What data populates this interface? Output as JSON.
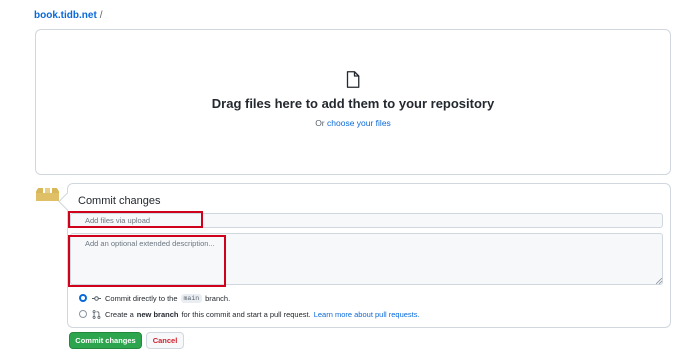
{
  "breadcrumb": {
    "repo": "book.tidb.net",
    "separator": "/"
  },
  "dropzone": {
    "title": "Drag files here to add them to your repository",
    "prefix": "Or",
    "link": "choose your files",
    "icon": "file-icon"
  },
  "commit": {
    "title": "Commit changes",
    "summary_placeholder": "Add files via upload",
    "description_placeholder": "Add an optional extended description...",
    "option_direct": {
      "prefix": "Commit directly to the",
      "branch": "main",
      "suffix": "branch.",
      "selected": true,
      "icon": "git-commit-icon"
    },
    "option_new_branch": {
      "prefix": "Create a",
      "bold": "new branch",
      "suffix": "for this commit and start a pull request.",
      "learn_more": "Learn more about pull requests.",
      "selected": false,
      "icon": "git-pull-request-icon"
    }
  },
  "buttons": {
    "commit": "Commit changes",
    "cancel": "Cancel"
  },
  "colors": {
    "accent": "#0969da",
    "primary_button": "#2da44e",
    "cancel_text": "#cf222e",
    "highlight": "#d0021b"
  }
}
